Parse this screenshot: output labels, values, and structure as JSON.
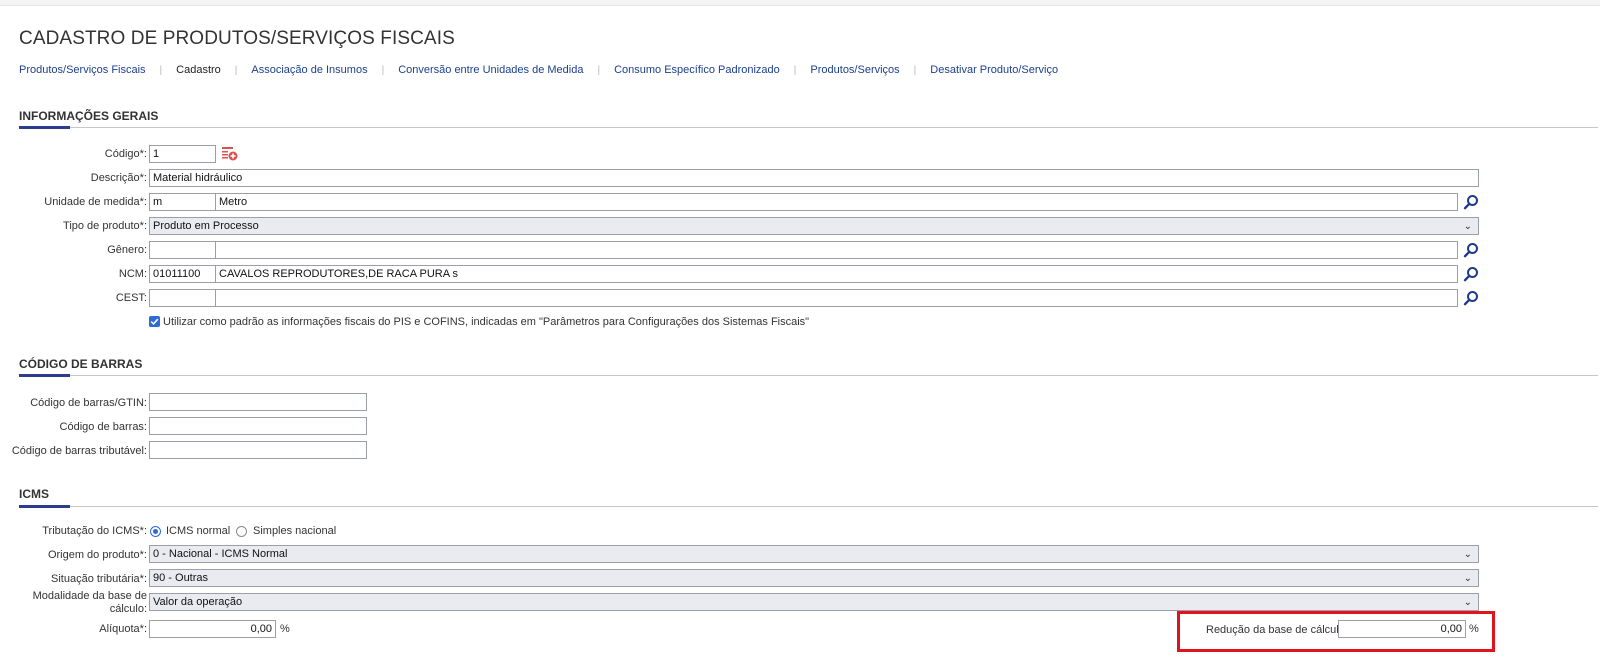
{
  "page": {
    "title": "CADASTRO DE PRODUTOS/SERVIÇOS FISCAIS"
  },
  "nav": [
    {
      "label": "Produtos/Serviços Fiscais",
      "active": false
    },
    {
      "label": "Cadastro",
      "active": true
    },
    {
      "label": "Associação de Insumos",
      "active": false
    },
    {
      "label": "Conversão entre Unidades de Medida",
      "active": false
    },
    {
      "label": "Consumo Específico Padronizado",
      "active": false
    },
    {
      "label": "Produtos/Serviços",
      "active": false
    },
    {
      "label": "Desativar Produto/Serviço",
      "active": false
    }
  ],
  "sections": {
    "general": "INFORMAÇÕES GERAIS",
    "barcode": "CÓDIGO DE BARRAS",
    "icms": "ICMS"
  },
  "general": {
    "codigo": {
      "label": "Código*:",
      "value": "1"
    },
    "descricao": {
      "label": "Descrição*:",
      "value": "Material hidráulico"
    },
    "unidade": {
      "label": "Unidade de medida*:",
      "code": "m",
      "name": "Metro"
    },
    "tipo": {
      "label": "Tipo de produto*:",
      "value": "Produto em Processo"
    },
    "genero": {
      "label": "Gênero:",
      "code": "",
      "name": ""
    },
    "ncm": {
      "label": "NCM:",
      "code": "01011100",
      "name": "CAVALOS REPRODUTORES,DE RACA PURA s"
    },
    "cest": {
      "label": "CEST:",
      "code": "",
      "name": ""
    },
    "pis_checkbox": {
      "checked": true,
      "label": "Utilizar como padrão as informações fiscais do PIS e COFINS, indicadas em \"Parâmetros para Configurações dos Sistemas Fiscais\""
    }
  },
  "barcode": {
    "gtin": {
      "label": "Código de barras/GTIN:",
      "value": ""
    },
    "codigo": {
      "label": "Código de barras:",
      "value": ""
    },
    "tributavel": {
      "label": "Código de barras tributável:",
      "value": ""
    }
  },
  "icms": {
    "tributacao": {
      "label": "Tributação do ICMS*:",
      "options": [
        "ICMS normal",
        "Simples nacional"
      ],
      "selected": "ICMS normal"
    },
    "origem": {
      "label": "Origem do produto*:",
      "value": "0 - Nacional - ICMS Normal"
    },
    "situacao": {
      "label": "Situação tributária*:",
      "value": "90 - Outras"
    },
    "modalidade": {
      "label_line1": "Modalidade da base de",
      "label_line2": "cálculo:",
      "value": "Valor da operação"
    },
    "aliquota": {
      "label": "Alíquota*:",
      "value": "0,00",
      "unit": "%"
    },
    "reducao": {
      "label": "Redução da base de cálculo:",
      "value": "0,00",
      "unit": "%"
    }
  },
  "colors": {
    "accent": "#2b3c8e",
    "link": "#1d3f8f",
    "highlight": "#e0141c",
    "icon_blue": "#1e3c8c"
  },
  "icons": {
    "lookup": "magnifier-icon",
    "generate_code": "generate-code-icon",
    "dropdown": "chevron-down-icon"
  }
}
